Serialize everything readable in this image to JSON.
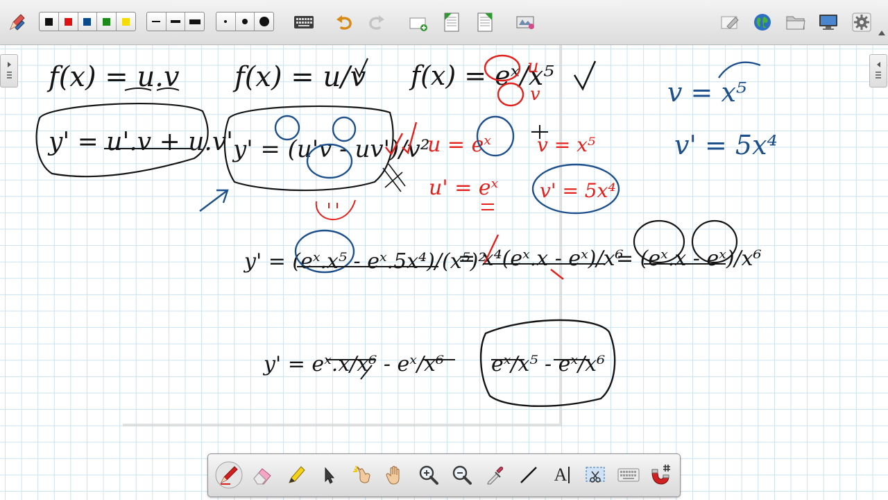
{
  "toolbar": {
    "colors": [
      "#111111",
      "#e01010",
      "#0a4a8c",
      "#1a8a1a",
      "#f5dc00"
    ],
    "text_tool_label": "A"
  },
  "board": {
    "ink_colors": {
      "black": "#141414",
      "blue": "#1d4f8a",
      "red": "#e3201b"
    },
    "grid_color": "#c9e3f1",
    "equations": {
      "product_rule": "f(x) = u.v",
      "product_rule_derivative": "y' = u'.v + u.v'",
      "quotient_rule": "f(x) = u/v",
      "quotient_rule_derivative": "y' = (u'v - uv')/v²",
      "problem": "f(x) = eˣ/x⁵",
      "u_def": "u = eˣ",
      "v_def": "v = x⁵",
      "u_prime": "u' = eˣ",
      "v_prime_red": "v' = 5x⁴",
      "v_side": "v = x⁵",
      "v_prime_side": "v' = 5x⁴",
      "step1": "y' = (eˣ.x⁵ - eˣ.5x⁴)/(x⁵)²",
      "step2": "= x⁴(eˣ.x - eˣ)/x⁶",
      "step3": "= (eˣ.x - eˣ)/x⁶",
      "step4": "y' = eˣ.x/x⁶ - eˣ/x⁶",
      "result": "eˣ/x⁵ - eˣ/x⁶"
    }
  }
}
